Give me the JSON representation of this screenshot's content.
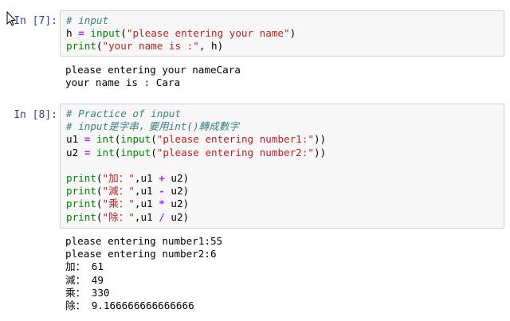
{
  "cells": [
    {
      "prompt": "In [7]:",
      "input_lines": [
        [
          {
            "t": "# input",
            "c": "cm"
          }
        ],
        [
          {
            "t": "h ",
            "c": ""
          },
          {
            "t": "=",
            "c": "op"
          },
          {
            "t": " ",
            "c": ""
          },
          {
            "t": "input",
            "c": "fn"
          },
          {
            "t": "(",
            "c": ""
          },
          {
            "t": "\"please entering your name\"",
            "c": "str"
          },
          {
            "t": ")",
            "c": ""
          }
        ],
        [
          {
            "t": "print",
            "c": "fn"
          },
          {
            "t": "(",
            "c": ""
          },
          {
            "t": "\"your name is :\"",
            "c": "str"
          },
          {
            "t": ", h)",
            "c": ""
          }
        ]
      ],
      "output_lines": [
        "please entering your nameCara",
        "your name is : Cara"
      ]
    },
    {
      "prompt": "In [8]:",
      "input_lines": [
        [
          {
            "t": "# Practice of input",
            "c": "cm"
          }
        ],
        [
          {
            "t": "# input是字串，要用int()轉成數字",
            "c": "cm"
          }
        ],
        [
          {
            "t": "u1 ",
            "c": ""
          },
          {
            "t": "=",
            "c": "op"
          },
          {
            "t": " ",
            "c": ""
          },
          {
            "t": "int",
            "c": "fn"
          },
          {
            "t": "(",
            "c": ""
          },
          {
            "t": "input",
            "c": "fn"
          },
          {
            "t": "(",
            "c": ""
          },
          {
            "t": "\"please entering number1:\"",
            "c": "str"
          },
          {
            "t": "))",
            "c": ""
          }
        ],
        [
          {
            "t": "u2 ",
            "c": ""
          },
          {
            "t": "=",
            "c": "op"
          },
          {
            "t": " ",
            "c": ""
          },
          {
            "t": "int",
            "c": "fn"
          },
          {
            "t": "(",
            "c": ""
          },
          {
            "t": "input",
            "c": "fn"
          },
          {
            "t": "(",
            "c": ""
          },
          {
            "t": "\"please entering number2:\"",
            "c": "str"
          },
          {
            "t": "))",
            "c": ""
          }
        ],
        [],
        [
          {
            "t": "print",
            "c": "fn"
          },
          {
            "t": "(",
            "c": ""
          },
          {
            "t": "\"加：\"",
            "c": "str"
          },
          {
            "t": ",u1 ",
            "c": ""
          },
          {
            "t": "+",
            "c": "op"
          },
          {
            "t": " u2)",
            "c": ""
          }
        ],
        [
          {
            "t": "print",
            "c": "fn"
          },
          {
            "t": "(",
            "c": ""
          },
          {
            "t": "\"減：\"",
            "c": "str"
          },
          {
            "t": ",u1 ",
            "c": ""
          },
          {
            "t": "-",
            "c": "op"
          },
          {
            "t": " u2)",
            "c": ""
          }
        ],
        [
          {
            "t": "print",
            "c": "fn"
          },
          {
            "t": "(",
            "c": ""
          },
          {
            "t": "\"乘：\"",
            "c": "str"
          },
          {
            "t": ",u1 ",
            "c": ""
          },
          {
            "t": "*",
            "c": "op"
          },
          {
            "t": " u2)",
            "c": ""
          }
        ],
        [
          {
            "t": "print",
            "c": "fn"
          },
          {
            "t": "(",
            "c": ""
          },
          {
            "t": "\"除：\"",
            "c": "str"
          },
          {
            "t": ",u1 ",
            "c": ""
          },
          {
            "t": "/",
            "c": "op"
          },
          {
            "t": " u2)",
            "c": ""
          }
        ]
      ],
      "output_lines": [
        "please entering number1:55",
        "please entering number2:6",
        "加： 61",
        "減： 49",
        "乘： 330",
        "除： 9.166666666666666"
      ]
    }
  ],
  "icons": {
    "cursor": "mouse-pointer-icon"
  },
  "colors": {
    "prompt": "#303f9f",
    "comment": "#408080",
    "builtin": "#008000",
    "operator": "#aa22ff",
    "string": "#ba2121",
    "cell_bg": "#f7f7f7",
    "cell_border": "#cfcfcf"
  }
}
